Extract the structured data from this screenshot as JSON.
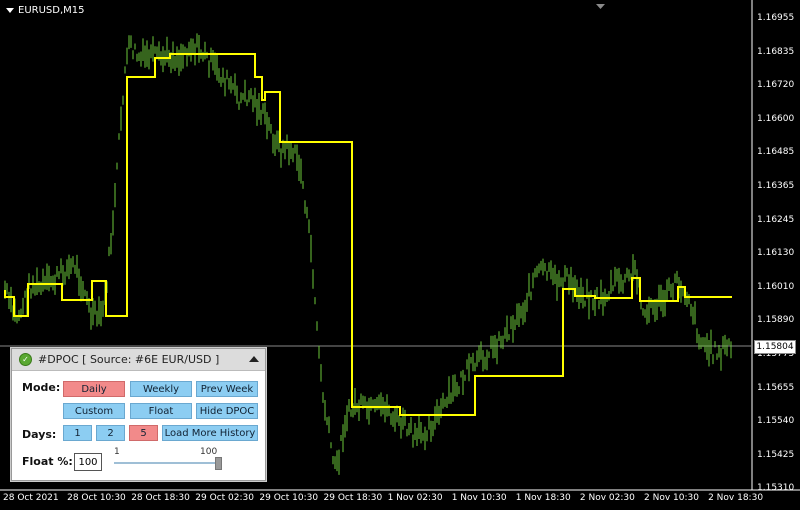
{
  "window": {
    "title": "EURUSD,M15"
  },
  "y_axis": [
    "1.16955",
    "1.16835",
    "1.16720",
    "1.16600",
    "1.16485",
    "1.16365",
    "1.16245",
    "1.16130",
    "1.16010",
    "1.15890",
    "1.15775",
    "1.15655",
    "1.15540",
    "1.15425",
    "1.15310"
  ],
  "current_price": "1.15804",
  "x_axis": [
    "28 Oct 2021",
    "28 Oct 10:30",
    "28 Oct 18:30",
    "29 Oct 02:30",
    "29 Oct 10:30",
    "29 Oct 18:30",
    "1 Nov 02:30",
    "1 Nov 10:30",
    "1 Nov 18:30",
    "2 Nov 02:30",
    "2 Nov 10:30",
    "2 Nov 18:30"
  ],
  "colors": {
    "price": "#6cc93a",
    "poc": "#ffff00",
    "background": "#000000"
  },
  "panel": {
    "title": "#DPOC [ Source: #6E EUR/USD ]",
    "mode_label": "Mode:",
    "days_label": "Days:",
    "float_label": "Float %:",
    "buttons": {
      "daily": "Daily",
      "weekly": "Weekly",
      "prev_week": "Prev Week",
      "custom": "Custom",
      "float": "Float",
      "hide_dpoc": "Hide DPOC",
      "d1": "1",
      "d2": "2",
      "d5": "5",
      "load_more": "Load More History"
    },
    "float_value": "100",
    "slider": {
      "min": "1",
      "max": "100",
      "value": 100
    }
  },
  "series": {
    "price_path": [
      [
        5,
        290
      ],
      [
        12,
        310
      ],
      [
        18,
        318
      ],
      [
        25,
        300
      ],
      [
        30,
        285
      ],
      [
        40,
        288
      ],
      [
        55,
        280
      ],
      [
        65,
        270
      ],
      [
        75,
        265
      ],
      [
        85,
        292
      ],
      [
        90,
        315
      ],
      [
        100,
        318
      ],
      [
        105,
        300
      ],
      [
        110,
        250
      ],
      [
        115,
        200
      ],
      [
        120,
        130
      ],
      [
        125,
        70
      ],
      [
        130,
        45
      ],
      [
        140,
        60
      ],
      [
        150,
        55
      ],
      [
        160,
        60
      ],
      [
        170,
        55
      ],
      [
        180,
        58
      ],
      [
        190,
        45
      ],
      [
        200,
        50
      ],
      [
        210,
        62
      ],
      [
        220,
        75
      ],
      [
        230,
        85
      ],
      [
        240,
        100
      ],
      [
        250,
        95
      ],
      [
        260,
        110
      ],
      [
        270,
        130
      ],
      [
        280,
        150
      ],
      [
        290,
        148
      ],
      [
        300,
        165
      ],
      [
        305,
        200
      ],
      [
        312,
        260
      ],
      [
        318,
        340
      ],
      [
        322,
        390
      ],
      [
        330,
        440
      ],
      [
        335,
        470
      ],
      [
        340,
        450
      ],
      [
        345,
        420
      ],
      [
        355,
        405
      ],
      [
        365,
        410
      ],
      [
        375,
        412
      ],
      [
        385,
        405
      ],
      [
        395,
        420
      ],
      [
        405,
        425
      ],
      [
        415,
        440
      ],
      [
        425,
        430
      ],
      [
        435,
        420
      ],
      [
        445,
        405
      ],
      [
        455,
        390
      ],
      [
        465,
        375
      ],
      [
        475,
        365
      ],
      [
        485,
        355
      ],
      [
        495,
        345
      ],
      [
        505,
        335
      ],
      [
        515,
        320
      ],
      [
        525,
        305
      ],
      [
        535,
        275
      ],
      [
        545,
        270
      ],
      [
        555,
        282
      ],
      [
        565,
        278
      ],
      [
        575,
        288
      ],
      [
        585,
        295
      ],
      [
        595,
        300
      ],
      [
        605,
        298
      ],
      [
        615,
        282
      ],
      [
        625,
        282
      ],
      [
        635,
        270
      ],
      [
        645,
        315
      ],
      [
        655,
        305
      ],
      [
        665,
        300
      ],
      [
        675,
        282
      ],
      [
        685,
        290
      ],
      [
        690,
        300
      ],
      [
        700,
        340
      ],
      [
        710,
        350
      ],
      [
        720,
        352
      ],
      [
        730,
        345
      ]
    ],
    "poc_path": [
      [
        5,
        290
      ],
      [
        5,
        297
      ],
      [
        14,
        297
      ],
      [
        14,
        316
      ],
      [
        28,
        316
      ],
      [
        28,
        284
      ],
      [
        62,
        284
      ],
      [
        62,
        300
      ],
      [
        92,
        300
      ],
      [
        92,
        281
      ],
      [
        106,
        281
      ],
      [
        106,
        316
      ],
      [
        127,
        316
      ],
      [
        127,
        77
      ],
      [
        155,
        77
      ],
      [
        155,
        58
      ],
      [
        170,
        58
      ],
      [
        170,
        54
      ],
      [
        255,
        54
      ],
      [
        255,
        77
      ],
      [
        262,
        77
      ],
      [
        262,
        100
      ],
      [
        265,
        100
      ],
      [
        265,
        92
      ],
      [
        280,
        92
      ],
      [
        280,
        142
      ],
      [
        352,
        142
      ],
      [
        352,
        407
      ],
      [
        400,
        407
      ],
      [
        400,
        415
      ],
      [
        475,
        415
      ],
      [
        475,
        376
      ],
      [
        563,
        376
      ],
      [
        563,
        289
      ],
      [
        575,
        289
      ],
      [
        575,
        296
      ],
      [
        595,
        296
      ],
      [
        595,
        298
      ],
      [
        632,
        298
      ],
      [
        632,
        278
      ],
      [
        640,
        278
      ],
      [
        640,
        301
      ],
      [
        678,
        301
      ],
      [
        678,
        287
      ],
      [
        685,
        287
      ],
      [
        685,
        297
      ],
      [
        732,
        297
      ]
    ]
  }
}
